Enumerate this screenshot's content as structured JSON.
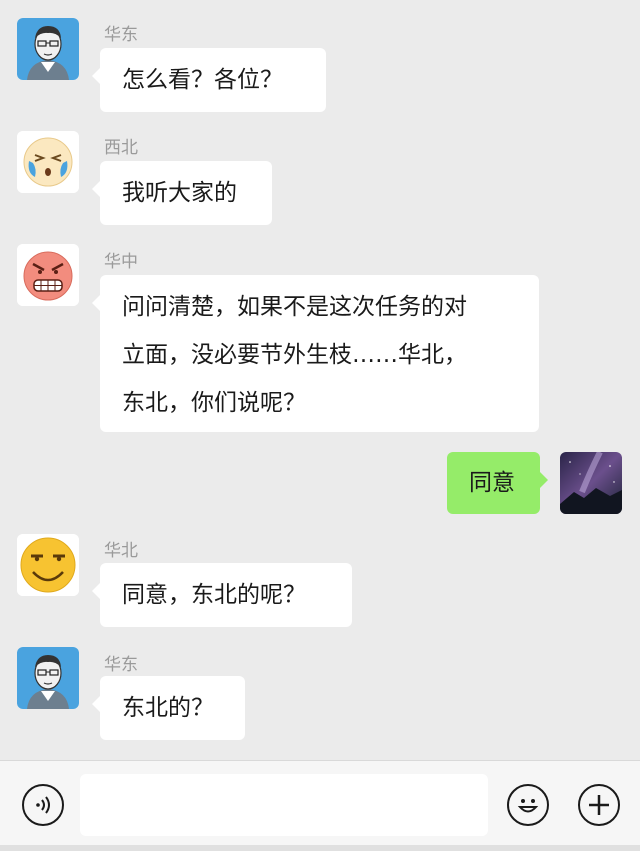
{
  "messages": [
    {
      "sender": "华东",
      "lines": [
        "怎么看？各位？"
      ]
    },
    {
      "sender": "西北",
      "lines": [
        "我听大家的"
      ]
    },
    {
      "sender": "华中",
      "lines": [
        "问问清楚，如果不是这次任务的对",
        "立面，没必要节外生枝……华北，",
        "东北，你们说呢？"
      ]
    },
    {
      "sender": "",
      "lines": [
        "同意"
      ],
      "self": true
    },
    {
      "sender": "华北",
      "lines": [
        "同意，东北的呢？"
      ]
    },
    {
      "sender": "华东",
      "lines": [
        "东北的？"
      ]
    }
  ],
  "avatars": {
    "huadong": "sketch-man-avatar",
    "xibei": "crying-laugh-emoji-avatar",
    "huazhong": "angry-emoji-avatar",
    "self": "galaxy-night-sky-avatar",
    "huabei": "smirk-emoji-avatar"
  },
  "input_bar": {
    "voice_icon": "voice-icon",
    "text_value": "",
    "emoji_icon": "emoji-icon",
    "more_icon": "plus-icon"
  },
  "colors": {
    "background": "#ebebeb",
    "bubble_other": "#ffffff",
    "bubble_self": "#95ec69",
    "sender_text": "#9a9a9a"
  }
}
